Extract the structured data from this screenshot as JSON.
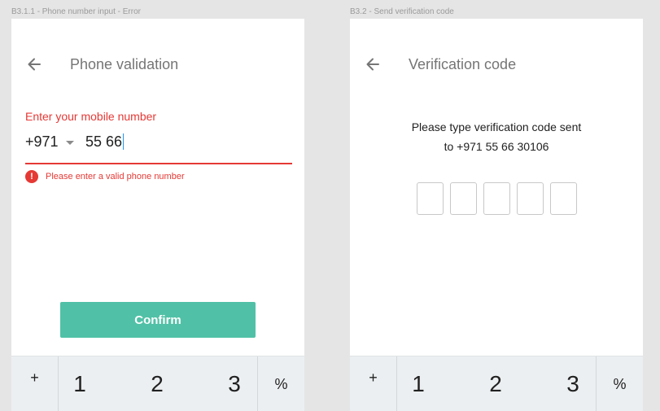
{
  "frame1": {
    "label": "B3.1.1 - Phone number input - Error",
    "title": "Phone validation",
    "field_label": "Enter your mobile number",
    "country_code": "+971",
    "phone_value": "55 66",
    "error_icon": "!",
    "error_message": "Please enter a valid phone number",
    "confirm_label": "Confirm"
  },
  "frame2": {
    "label": "B3.2 - Send verification code",
    "title": "Verification code",
    "instruction_line1": "Please type verification code sent",
    "instruction_line2": "to +971 55 66 30106"
  },
  "keypad": {
    "plus": "+",
    "one": "1",
    "two": "2",
    "three": "3",
    "percent": "%"
  },
  "colors": {
    "error": "#e53935",
    "accent": "#50c1a6",
    "keypad_bg": "#eceff1"
  },
  "icons": {
    "back": "arrow-left-icon",
    "dropdown": "caret-down-icon",
    "error": "error-circle-icon"
  }
}
